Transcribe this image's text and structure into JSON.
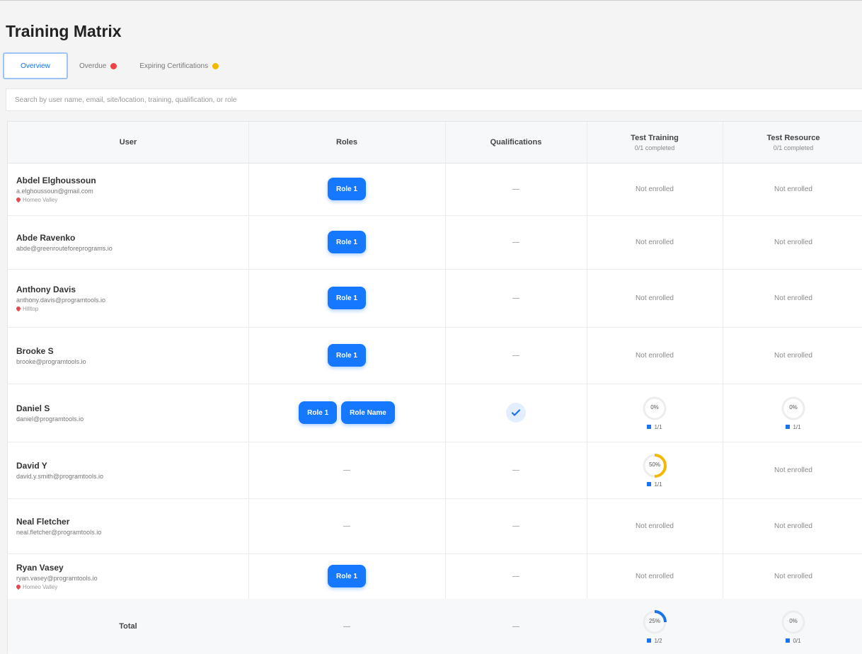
{
  "title": "Training Matrix",
  "tabs": [
    {
      "label": "Overview",
      "badge": ""
    },
    {
      "label": "Overdue",
      "badge": "red"
    },
    {
      "label": "Expiring Certifications",
      "badge": "yellow"
    }
  ],
  "search": {
    "placeholder": "Search by user name, email, site/location, training, qualification, or role"
  },
  "columns": {
    "user": "User",
    "roles": "Roles",
    "qualifications": "Qualifications",
    "test_training": {
      "label": "Test Training",
      "sub": "0/1 completed"
    },
    "test_resource": {
      "label": "Test Resource",
      "sub": "0/1 completed"
    }
  },
  "rows": [
    {
      "name": "Abdel Elghoussoun",
      "email": "a.elghoussoun@gmail.com",
      "location": "Homeo Valley",
      "roles": [
        "Role 1"
      ],
      "qual": "—",
      "training": "Not enrolled",
      "resource": "Not enrolled"
    },
    {
      "name": "Abde Ravenko",
      "email": "abde@greenrouteforeprograms.io",
      "location": "",
      "roles": [
        "Role 1"
      ],
      "qual": "—",
      "training": "Not enrolled",
      "resource": "Not enrolled"
    },
    {
      "name": "Anthony Davis",
      "email": "anthony.davis@programtools.io",
      "location": "Hilltop",
      "roles": [
        "Role 1"
      ],
      "qual": "—",
      "training": "Not enrolled",
      "resource": "Not enrolled"
    },
    {
      "name": "Brooke S",
      "email": "brooke@programtools.io",
      "location": "",
      "roles": [
        "Role 1"
      ],
      "qual": "—",
      "training": "Not enrolled",
      "resource": "Not enrolled"
    },
    {
      "name": "Daniel S",
      "email": "daniel@programtools.io",
      "location": "",
      "roles": [
        "Role 1",
        "Role Name"
      ],
      "qual": "check",
      "training": {
        "pct": 0,
        "label": "0%",
        "legend": "1/1"
      },
      "resource": {
        "pct": 0,
        "label": "0%",
        "legend": "1/1"
      }
    },
    {
      "name": "David Y",
      "email": "david.y.smith@programtools.io",
      "location": "",
      "roles": [],
      "qual": "—",
      "training": {
        "pct": 50,
        "label": "50%",
        "legend": "1/1",
        "color": "#f5b800"
      },
      "resource": "Not enrolled"
    },
    {
      "name": "Neal Fletcher",
      "email": "neal.fletcher@programtools.io",
      "location": "",
      "roles": [],
      "qual": "—",
      "training": "Not enrolled",
      "resource": "Not enrolled"
    },
    {
      "name": "Ryan Vasey",
      "email": "ryan.vasey@programtools.io",
      "location": "Homeo Valley",
      "roles": [
        "Role 1"
      ],
      "qual": "—",
      "training": "Not enrolled",
      "resource": "Not enrolled"
    }
  ],
  "roles_dash": "—",
  "total": {
    "label": "Total",
    "roles": "—",
    "qual": "—",
    "training": {
      "pct": 25,
      "label": "25%",
      "sub": "1/2",
      "color": "#1a73e8"
    },
    "resource": {
      "pct": 0,
      "label": "0%",
      "sub": "0/1"
    }
  }
}
